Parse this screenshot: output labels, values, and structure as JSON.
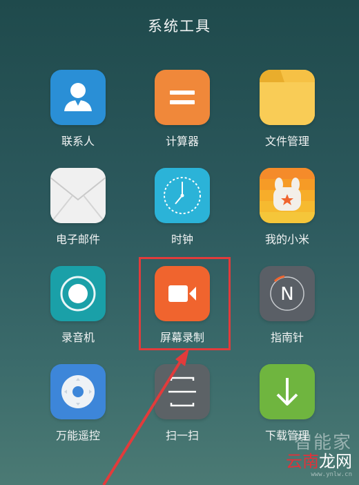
{
  "folder": {
    "title": "系统工具"
  },
  "apps": [
    {
      "label": "联系人",
      "icon": "contacts-icon"
    },
    {
      "label": "计算器",
      "icon": "calculator-icon"
    },
    {
      "label": "文件管理",
      "icon": "folder-icon"
    },
    {
      "label": "电子邮件",
      "icon": "email-icon"
    },
    {
      "label": "时钟",
      "icon": "clock-icon"
    },
    {
      "label": "我的小米",
      "icon": "mi-bunny-icon"
    },
    {
      "label": "录音机",
      "icon": "recorder-icon"
    },
    {
      "label": "屏幕录制",
      "icon": "screen-record-icon"
    },
    {
      "label": "指南针",
      "icon": "compass-icon"
    },
    {
      "label": "万能遥控",
      "icon": "remote-control-icon"
    },
    {
      "label": "扫一扫",
      "icon": "scan-icon"
    },
    {
      "label": "下载管理",
      "icon": "download-icon"
    }
  ],
  "watermark": {
    "line1": "智能家",
    "red_part": "云南",
    "white_part": "龙网",
    "url": "www.ynlw.cn"
  },
  "colors": {
    "highlight": "#e23b3b",
    "contacts": "#2a8fd6",
    "calculator": "#f0883a",
    "files": "#f6c145",
    "clock": "#2bb3d8",
    "recorder": "#1aa0a8",
    "screen_record": "#f0642e",
    "compass": "#5a5f66",
    "remote": "#3d86d9",
    "scan": "#5c6266",
    "download": "#6fb53f"
  }
}
